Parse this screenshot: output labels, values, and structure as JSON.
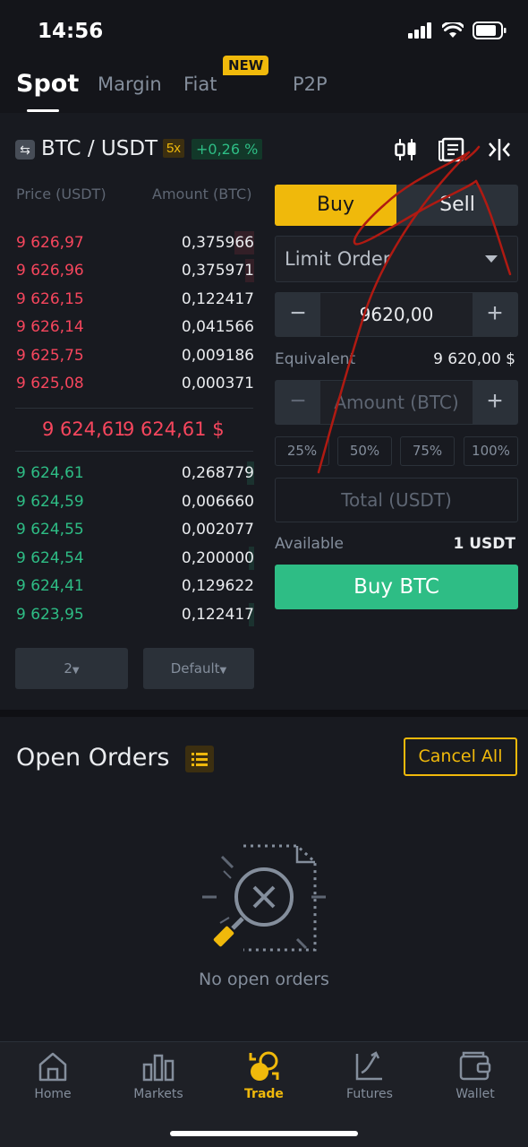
{
  "status_bar": {
    "time": "14:56"
  },
  "top_tabs": {
    "items": [
      {
        "label": "Spot",
        "active": true
      },
      {
        "label": "Margin",
        "active": false
      },
      {
        "label": "Fiat",
        "active": false
      },
      {
        "label": "P2P",
        "active": false
      }
    ],
    "new_badge": "NEW"
  },
  "pair": {
    "name": "BTC / USDT",
    "leverage": "5x",
    "change": "+0,26 %",
    "tools": [
      "candlestick-chart-icon",
      "orders-document-icon",
      "split-view-icon"
    ]
  },
  "order_book": {
    "header_price": "Price (USDT)",
    "header_amount": "Amount (BTC)",
    "asks": [
      {
        "price": "9 626,97",
        "amount": "0,375966"
      },
      {
        "price": "9 626,96",
        "amount": "0,375971"
      },
      {
        "price": "9 626,15",
        "amount": "0,122417"
      },
      {
        "price": "9 626,14",
        "amount": "0,041566"
      },
      {
        "price": "9 625,75",
        "amount": "0,009186"
      },
      {
        "price": "9 625,08",
        "amount": "0,000371"
      }
    ],
    "last_price": "9 624,61",
    "last_price_fiat": "9 624,61 $",
    "bids": [
      {
        "price": "9 624,61",
        "amount": "0,268779"
      },
      {
        "price": "9 624,59",
        "amount": "0,006660"
      },
      {
        "price": "9 624,55",
        "amount": "0,002077"
      },
      {
        "price": "9 624,54",
        "amount": "0,200000"
      },
      {
        "price": "9 624,41",
        "amount": "0,129622"
      },
      {
        "price": "9 623,95",
        "amount": "0,122417"
      }
    ],
    "precision_label": "2",
    "view_label": "Default"
  },
  "order_form": {
    "buy_label": "Buy",
    "sell_label": "Sell",
    "order_type": "Limit Order",
    "price_value": "9620,00",
    "equivalent_label": "Equivalent",
    "equivalent_value": "9 620,00 $",
    "amount_placeholder": "Amount (BTC)",
    "percentages": [
      "25%",
      "50%",
      "75%",
      "100%"
    ],
    "total_placeholder": "Total (USDT)",
    "available_label": "Available",
    "available_value": "1 USDT",
    "submit_label": "Buy BTC"
  },
  "open_orders": {
    "title": "Open Orders",
    "cancel_all": "Cancel All",
    "empty_text": "No open orders"
  },
  "bottom_nav": {
    "items": [
      {
        "label": "Home",
        "icon": "home-icon"
      },
      {
        "label": "Markets",
        "icon": "markets-icon"
      },
      {
        "label": "Trade",
        "icon": "trade-icon",
        "active": true
      },
      {
        "label": "Futures",
        "icon": "futures-icon"
      },
      {
        "label": "Wallet",
        "icon": "wallet-icon"
      }
    ]
  },
  "colors": {
    "accent": "#f0b90b",
    "buy": "#2ebd85",
    "sell": "#f6465d",
    "background": "#181a20",
    "annotation": "#b01a12"
  }
}
